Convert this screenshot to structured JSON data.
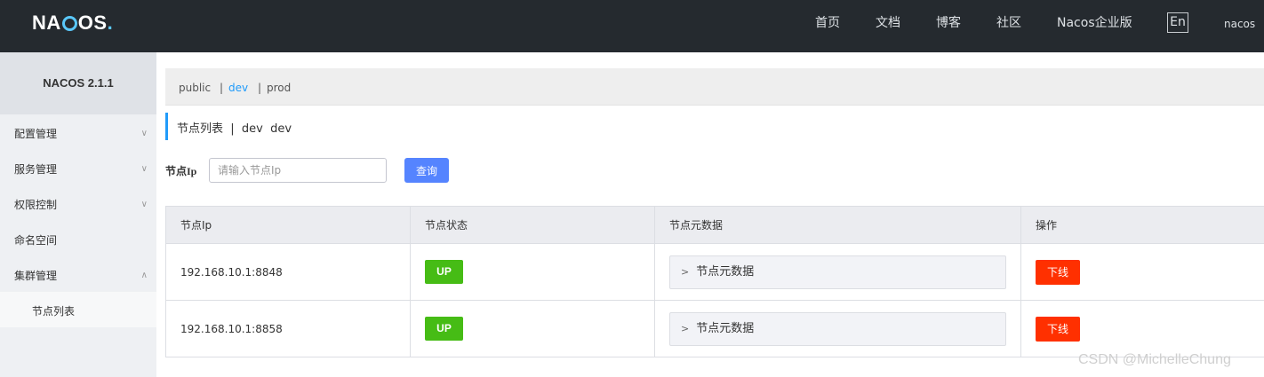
{
  "header": {
    "logo": "NACOS.",
    "nav": [
      "首页",
      "文档",
      "博客",
      "社区",
      "Nacos企业版"
    ],
    "lang": "En",
    "user": "nacos"
  },
  "sidebar": {
    "version": "NACOS 2.1.1",
    "items": [
      {
        "label": "配置管理",
        "chevron": "chevron-down-icon"
      },
      {
        "label": "服务管理",
        "chevron": "chevron-down-icon"
      },
      {
        "label": "权限控制",
        "chevron": "chevron-down-icon"
      },
      {
        "label": "命名空间"
      },
      {
        "label": "集群管理",
        "chevron": "chevron-up-icon"
      }
    ],
    "sub_items": [
      {
        "label": "节点列表"
      }
    ]
  },
  "namespaces": {
    "items": [
      "public",
      "dev",
      "prod"
    ],
    "separator": "|",
    "active": "dev"
  },
  "page": {
    "title": "节点列表  |  dev  dev"
  },
  "search": {
    "label": "节点Ip",
    "placeholder": "请输入节点Ip",
    "button": "查询"
  },
  "table": {
    "columns": [
      "节点Ip",
      "节点状态",
      "节点元数据",
      "操作"
    ],
    "rows": [
      {
        "ip": "192.168.10.1:8848",
        "status": "UP",
        "metadata": "节点元数据",
        "action": "下线"
      },
      {
        "ip": "192.168.10.1:8858",
        "status": "UP",
        "metadata": "节点元数据",
        "action": "下线"
      }
    ]
  },
  "watermark": "CSDN @MichelleChung",
  "colors": {
    "header_bg": "#252a2f",
    "accent": "#209bfa",
    "primary_button": "#5584ff",
    "status_up": "#46bc15",
    "danger": "#ff3000"
  }
}
